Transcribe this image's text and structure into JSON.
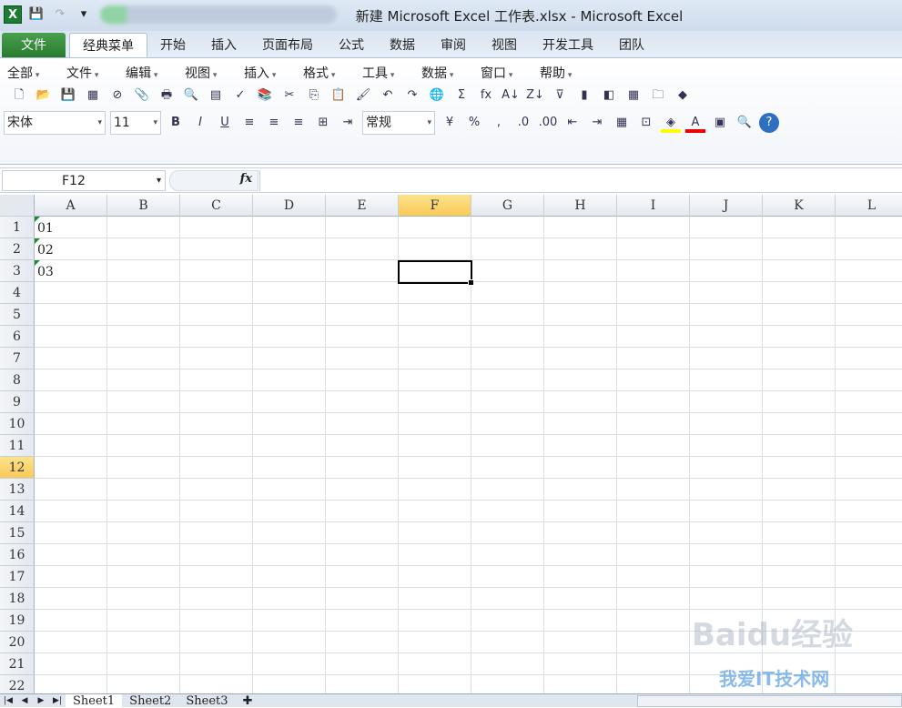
{
  "window": {
    "title": "新建 Microsoft Excel 工作表.xlsx - Microsoft Excel"
  },
  "ribbon_tabs": [
    "文件",
    "经典菜单",
    "开始",
    "插入",
    "页面布局",
    "公式",
    "数据",
    "审阅",
    "视图",
    "开发工具",
    "团队"
  ],
  "classic_menu": [
    "全部",
    "文件",
    "编辑",
    "视图",
    "插入",
    "格式",
    "工具",
    "数据",
    "窗口",
    "帮助"
  ],
  "toolbar1_icons": [
    [
      "new-icon",
      "🗋"
    ],
    [
      "open-icon",
      "📂"
    ],
    [
      "save-icon",
      "💾"
    ],
    [
      "excel-icon",
      "▦"
    ],
    [
      "permission-icon",
      "⊘"
    ],
    [
      "attach-icon",
      "📎"
    ],
    [
      "print-icon",
      "🖶"
    ],
    [
      "print-preview-icon",
      "🔍"
    ],
    [
      "print-area-icon",
      "▤"
    ],
    [
      "spelling-icon",
      "✓"
    ],
    [
      "research-icon",
      "📚"
    ],
    [
      "cut-icon",
      "✂"
    ],
    [
      "copy-icon",
      "⎘"
    ],
    [
      "paste-icon",
      "📋"
    ],
    [
      "format-painter-icon",
      "🖌"
    ],
    [
      "undo-icon",
      "↶"
    ],
    [
      "redo-icon",
      "↷"
    ],
    [
      "hyperlink-icon",
      "🌐"
    ],
    [
      "sum-icon",
      "Σ"
    ],
    [
      "function-icon",
      "fx"
    ],
    [
      "sort-asc-icon",
      "A↓"
    ],
    [
      "sort-desc-icon",
      "Z↓"
    ],
    [
      "filter-icon",
      "⊽"
    ],
    [
      "chart-icon",
      "▮"
    ],
    [
      "shapes-icon",
      "◧"
    ],
    [
      "table-icon",
      "▦"
    ],
    [
      "folder-icon",
      "🗀"
    ],
    [
      "warning-icon",
      "◆"
    ]
  ],
  "font": {
    "name": "宋体",
    "size": "11",
    "number_format": "常规"
  },
  "toolbar2_icons": [
    [
      "bold-icon",
      "B"
    ],
    [
      "italic-icon",
      "I"
    ],
    [
      "underline-icon",
      "U"
    ],
    [
      "align-left-icon",
      "≡"
    ],
    [
      "align-center-icon",
      "≡"
    ],
    [
      "align-right-icon",
      "≡"
    ],
    [
      "merge-icon",
      "⊞"
    ],
    [
      "wrap-icon",
      "⇥"
    ],
    [
      "currency-icon",
      "¥"
    ],
    [
      "percent-icon",
      "%"
    ],
    [
      "comma-icon",
      ","
    ],
    [
      "inc-decimal-icon",
      ".0"
    ],
    [
      "dec-decimal-icon",
      ".00"
    ],
    [
      "indent-dec-icon",
      "⇤"
    ],
    [
      "indent-inc-icon",
      "⇥"
    ],
    [
      "cell-style-icon",
      "▦"
    ],
    [
      "borders-icon",
      "⊡"
    ],
    [
      "fill-color-icon",
      "◈"
    ],
    [
      "font-color-icon",
      "A"
    ],
    [
      "styles-icon",
      "▣"
    ],
    [
      "find-icon",
      "🔍"
    ],
    [
      "help-icon",
      "?"
    ]
  ],
  "formula_bar": {
    "name_box": "F12",
    "fx": "fx",
    "value": ""
  },
  "columns": [
    "A",
    "B",
    "C",
    "D",
    "E",
    "F",
    "G",
    "H",
    "I",
    "J",
    "K",
    "L"
  ],
  "rows": [
    "1",
    "2",
    "3",
    "4",
    "5",
    "6",
    "7",
    "8",
    "9",
    "10",
    "11",
    "12",
    "13",
    "14",
    "15",
    "16",
    "17",
    "18",
    "19",
    "20",
    "21",
    "22"
  ],
  "cells": {
    "A1": "01",
    "A2": "02",
    "A3": "03"
  },
  "sheets": [
    "Sheet1",
    "Sheet2",
    "Sheet3"
  ],
  "watermark": {
    "baidu": "Baidu经验",
    "site": "我爱IT技术网"
  },
  "colors": {
    "accent_green": "#257a2c",
    "selected_header": "#f8c958"
  }
}
